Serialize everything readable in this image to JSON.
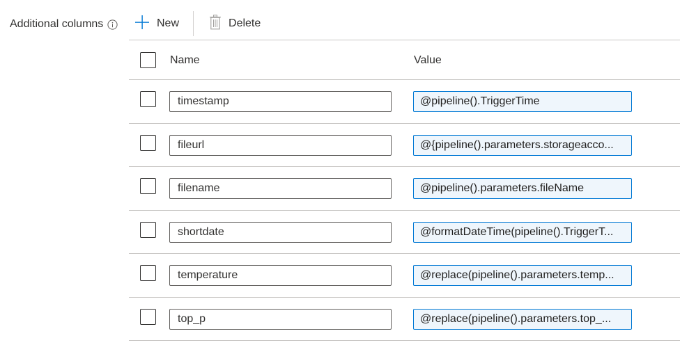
{
  "section": {
    "label": "Additional columns"
  },
  "toolbar": {
    "new_label": "New",
    "delete_label": "Delete"
  },
  "table": {
    "headers": {
      "name": "Name",
      "value": "Value"
    },
    "rows": [
      {
        "name": "timestamp",
        "value": "@pipeline().TriggerTime"
      },
      {
        "name": "fileurl",
        "value": "@{pipeline().parameters.storageacco..."
      },
      {
        "name": "filename",
        "value": "@pipeline().parameters.fileName"
      },
      {
        "name": "shortdate",
        "value": "@formatDateTime(pipeline().TriggerT..."
      },
      {
        "name": "temperature",
        "value": "@replace(pipeline().parameters.temp..."
      },
      {
        "name": "top_p",
        "value": "@replace(pipeline().parameters.top_..."
      }
    ]
  },
  "icons": {
    "info": "info-icon",
    "new": "plus-icon",
    "delete": "trash-icon"
  },
  "colors": {
    "accent": "#0078d4",
    "value_field_bg": "#eff6fc",
    "border": "#605e5c",
    "divider": "#c8c6c4"
  }
}
